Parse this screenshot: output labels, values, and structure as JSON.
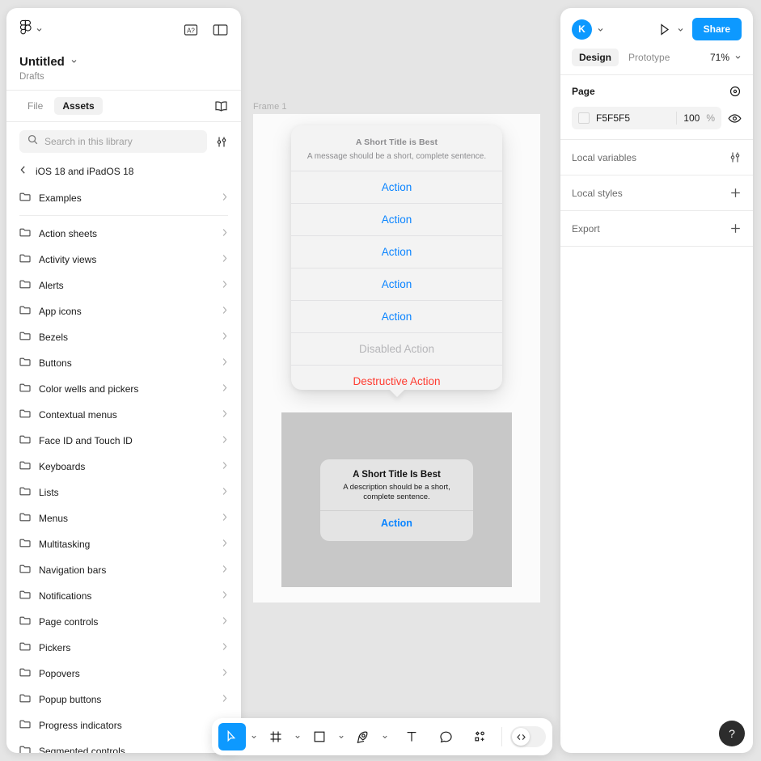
{
  "left_panel": {
    "figma_logo_icon": "figma-logo",
    "header_icons": [
      "localization-a-question-icon",
      "panel-layout-icon"
    ],
    "file_name": "Untitled",
    "file_location": "Drafts",
    "tabs": [
      {
        "label": "File",
        "active": false
      },
      {
        "label": "Assets",
        "active": true
      }
    ],
    "book_icon": "library-book-icon",
    "search": {
      "placeholder": "Search in this library",
      "value": "",
      "icon": "search-icon",
      "filter_icon": "sliders-filter-icon"
    },
    "library": {
      "back_icon": "chevron-left-icon",
      "name": "iOS 18 and iPadOS 18"
    },
    "top_items": [
      {
        "label": "Examples",
        "icon": "folder-icon",
        "chevron": "chevron-right-icon"
      }
    ],
    "items": [
      {
        "label": "Action sheets",
        "icon": "folder-icon",
        "chevron": "chevron-right-icon"
      },
      {
        "label": "Activity views",
        "icon": "folder-icon",
        "chevron": "chevron-right-icon"
      },
      {
        "label": "Alerts",
        "icon": "folder-icon",
        "chevron": "chevron-right-icon"
      },
      {
        "label": "App icons",
        "icon": "folder-icon",
        "chevron": "chevron-right-icon"
      },
      {
        "label": "Bezels",
        "icon": "folder-icon",
        "chevron": "chevron-right-icon"
      },
      {
        "label": "Buttons",
        "icon": "folder-icon",
        "chevron": "chevron-right-icon"
      },
      {
        "label": "Color wells and pickers",
        "icon": "folder-icon",
        "chevron": "chevron-right-icon"
      },
      {
        "label": "Contextual menus",
        "icon": "folder-icon",
        "chevron": "chevron-right-icon"
      },
      {
        "label": "Face ID and Touch ID",
        "icon": "folder-icon",
        "chevron": "chevron-right-icon"
      },
      {
        "label": "Keyboards",
        "icon": "folder-icon",
        "chevron": "chevron-right-icon"
      },
      {
        "label": "Lists",
        "icon": "folder-icon",
        "chevron": "chevron-right-icon"
      },
      {
        "label": "Menus",
        "icon": "folder-icon",
        "chevron": "chevron-right-icon"
      },
      {
        "label": "Multitasking",
        "icon": "folder-icon",
        "chevron": "chevron-right-icon"
      },
      {
        "label": "Navigation bars",
        "icon": "folder-icon",
        "chevron": "chevron-right-icon"
      },
      {
        "label": "Notifications",
        "icon": "folder-icon",
        "chevron": "chevron-right-icon"
      },
      {
        "label": "Page controls",
        "icon": "folder-icon",
        "chevron": "chevron-right-icon"
      },
      {
        "label": "Pickers",
        "icon": "folder-icon",
        "chevron": "chevron-right-icon"
      },
      {
        "label": "Popovers",
        "icon": "folder-icon",
        "chevron": "chevron-right-icon"
      },
      {
        "label": "Popup buttons",
        "icon": "folder-icon",
        "chevron": "chevron-right-icon"
      },
      {
        "label": "Progress indicators",
        "icon": "folder-icon",
        "chevron": "chevron-right-icon"
      },
      {
        "label": "Segmented controls",
        "icon": "folder-icon",
        "chevron": "chevron-right-icon"
      }
    ]
  },
  "canvas": {
    "frame_label": "Frame 1",
    "action_sheet": {
      "title": "A Short Title is Best",
      "message": "A message should be a short, complete sentence.",
      "rows": [
        {
          "label": "Action",
          "style": "default"
        },
        {
          "label": "Action",
          "style": "default"
        },
        {
          "label": "Action",
          "style": "default"
        },
        {
          "label": "Action",
          "style": "default"
        },
        {
          "label": "Action",
          "style": "default"
        },
        {
          "label": "Disabled Action",
          "style": "disabled"
        },
        {
          "label": "Destructive Action",
          "style": "destructive"
        }
      ]
    },
    "alert": {
      "title": "A Short Title Is Best",
      "description": "A description should be a short, complete sentence.",
      "action": "Action"
    }
  },
  "right_panel": {
    "avatar_initial": "K",
    "avatar_caret_icon": "chevron-down-icon",
    "present_icon": "play-present-icon",
    "present_caret_icon": "chevron-down-icon",
    "share_label": "Share",
    "tabs": [
      {
        "label": "Design",
        "active": true
      },
      {
        "label": "Prototype",
        "active": false
      }
    ],
    "zoom_level": "71%",
    "zoom_caret_icon": "chevron-down-icon",
    "page": {
      "title": "Page",
      "settings_icon": "page-settings-icon",
      "color_hex": "F5F5F5",
      "color_value": "#F5F5F5",
      "opacity": "100",
      "opacity_unit": "%",
      "visibility_icon": "eye-icon"
    },
    "sections": [
      {
        "title": "Local variables",
        "action_icon": "sliders-filter-icon"
      },
      {
        "title": "Local styles",
        "action_icon": "plus-icon"
      },
      {
        "title": "Export",
        "action_icon": "plus-icon"
      }
    ]
  },
  "toolbar": {
    "tools": [
      {
        "name": "move-cursor-tool",
        "icon": "cursor-arrow-icon",
        "active": true,
        "caret": true
      },
      {
        "name": "frame-tool",
        "icon": "frame-grid-icon",
        "active": false,
        "caret": true
      },
      {
        "name": "shape-tool",
        "icon": "square-icon",
        "active": false,
        "caret": true
      },
      {
        "name": "pen-tool",
        "icon": "pen-nib-icon",
        "active": false,
        "caret": true
      },
      {
        "name": "text-tool",
        "icon": "text-t-icon",
        "active": false,
        "caret": false
      },
      {
        "name": "comment-tool",
        "icon": "comment-bubble-icon",
        "active": false,
        "caret": false
      },
      {
        "name": "actions-tool",
        "icon": "components-plus-icon",
        "active": false,
        "caret": false
      }
    ],
    "dev_mode": {
      "icon": "code-brackets-icon",
      "enabled": false
    }
  },
  "help": {
    "label": "?",
    "icon": "question-mark-icon"
  },
  "colors": {
    "accent": "#0d99ff",
    "action_blue": "#0a84ff",
    "destructive_red": "#ff3b30",
    "canvas_bg": "#e5e5e5",
    "frame_bg": "#fbfbfb"
  }
}
